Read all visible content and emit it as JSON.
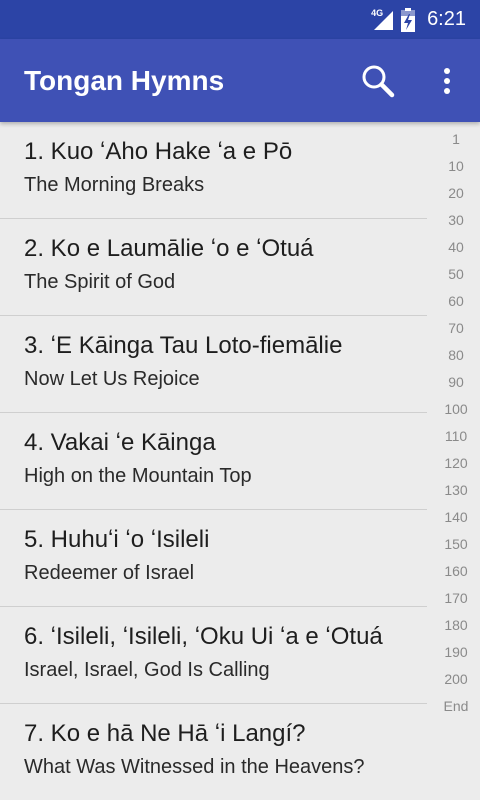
{
  "status_bar": {
    "network": "4G",
    "time": "6:21"
  },
  "app_bar": {
    "title": "Tongan Hymns",
    "search_icon": "search-icon",
    "overflow_icon": "more-vert-icon"
  },
  "hymns": [
    {
      "title": "1. Kuo ʻAho Hake ʻa e Pō",
      "subtitle": "The Morning Breaks"
    },
    {
      "title": "2. Ko e Laumālie ʻo e ʻOtuá",
      "subtitle": "The Spirit of God"
    },
    {
      "title": "3. ʻE Kāinga Tau Loto-fiemālie",
      "subtitle": "Now Let Us Rejoice"
    },
    {
      "title": "4. Vakai ʻe Kāinga",
      "subtitle": "High on the Mountain Top"
    },
    {
      "title": "5. Huhuʻi ʻo ʻIsileli",
      "subtitle": "Redeemer of Israel"
    },
    {
      "title": "6. ʻIsileli, ʻIsileli, ʻOku Ui ʻa e ʻOtuá",
      "subtitle": "Israel, Israel, God Is Calling"
    },
    {
      "title": "7. Ko e hā Ne Hā ʻi Langí?",
      "subtitle": "What Was Witnessed in the Heavens?"
    }
  ],
  "index": [
    "1",
    "10",
    "20",
    "30",
    "40",
    "50",
    "60",
    "70",
    "80",
    "90",
    "100",
    "110",
    "120",
    "130",
    "140",
    "150",
    "160",
    "170",
    "180",
    "190",
    "200",
    "End"
  ]
}
